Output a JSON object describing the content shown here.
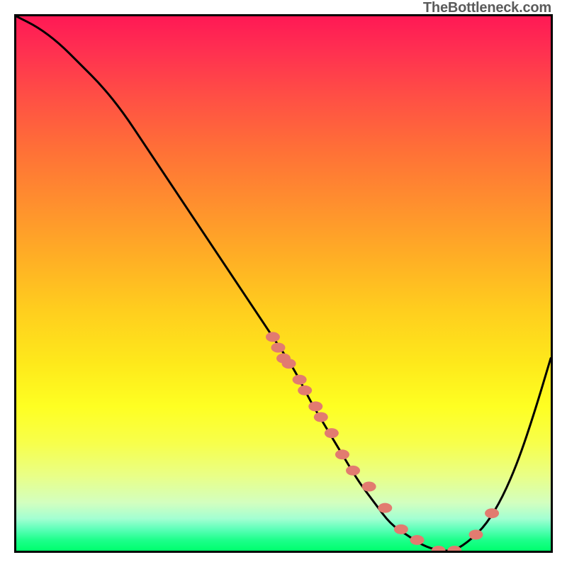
{
  "watermark": "TheBottleneck.com",
  "chart_data": {
    "type": "line",
    "title": "",
    "xlabel": "",
    "ylabel": "",
    "xlim": [
      0,
      100
    ],
    "ylim": [
      0,
      100
    ],
    "grid": false,
    "legend": false,
    "series": [
      {
        "name": "curve",
        "style": "line",
        "color": "#000000",
        "x": [
          0,
          4,
          8,
          12,
          16,
          20,
          24,
          28,
          32,
          36,
          40,
          44,
          48,
          52,
          55,
          58,
          61,
          64,
          67,
          70,
          73,
          76,
          79,
          82,
          85,
          88,
          91,
          94,
          97,
          100
        ],
        "y": [
          100,
          98,
          95,
          91,
          87,
          82,
          76,
          70,
          64,
          58,
          52,
          46,
          40,
          34,
          28,
          23,
          18,
          13,
          9,
          5,
          3,
          1,
          0,
          0,
          2,
          5,
          10,
          17,
          26,
          36
        ]
      },
      {
        "name": "markers",
        "style": "scatter",
        "color": "#e27b70",
        "x": [
          48,
          49,
          50,
          51,
          53,
          54,
          56,
          57,
          59,
          61,
          63,
          66,
          69,
          72,
          75,
          79,
          82,
          86,
          89
        ],
        "y": [
          40,
          38,
          36,
          35,
          32,
          30,
          27,
          25,
          22,
          18,
          15,
          12,
          8,
          4,
          2,
          0,
          0,
          3,
          7
        ]
      }
    ],
    "background_gradient": {
      "top": "#ff1955",
      "mid": "#fee91b",
      "bottom": "#00ff6d"
    }
  }
}
